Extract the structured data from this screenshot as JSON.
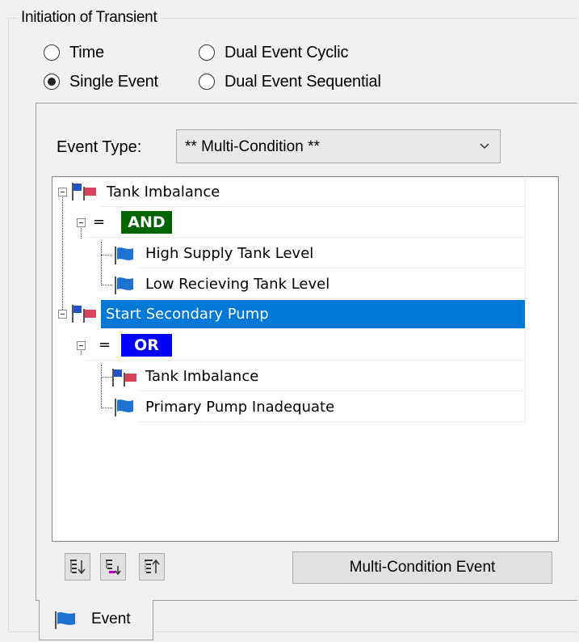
{
  "group": {
    "title": "Initiation of Transient"
  },
  "radios": [
    {
      "label": "Time",
      "checked": false
    },
    {
      "label": "Dual Event Cyclic",
      "checked": false
    },
    {
      "label": "Single Event",
      "checked": true
    },
    {
      "label": "Dual Event Sequential",
      "checked": false
    }
  ],
  "event_type": {
    "label": "Event Type:",
    "value": "** Multi-Condition **"
  },
  "tree": {
    "nodes": [
      {
        "label": "Tank Imbalance",
        "icon": "multi-flag-icon",
        "selected": false
      },
      {
        "operator": "AND",
        "operator_color": "#006400"
      },
      {
        "label": "High Supply Tank Level",
        "icon": "blue-flag-icon"
      },
      {
        "label": "Low Recieving Tank Level",
        "icon": "blue-flag-icon"
      },
      {
        "label": "Start Secondary Pump",
        "icon": "multi-flag-icon",
        "selected": true
      },
      {
        "operator": "OR",
        "operator_color": "#0000ff"
      },
      {
        "label": "Tank Imbalance",
        "icon": "multi-flag-icon"
      },
      {
        "label": "Primary Pump Inadequate",
        "icon": "blue-flag-icon"
      }
    ],
    "equals": "="
  },
  "buttons": {
    "multi_condition": "Multi-Condition Event",
    "tool_icons": [
      "expand-all-icon",
      "add-condition-icon",
      "collapse-all-icon"
    ]
  },
  "tab": {
    "label": "Event",
    "icon": "blue-flag-icon"
  },
  "colors": {
    "selection": "#0078d7",
    "and_badge": "#006400",
    "or_badge": "#0000ff"
  }
}
